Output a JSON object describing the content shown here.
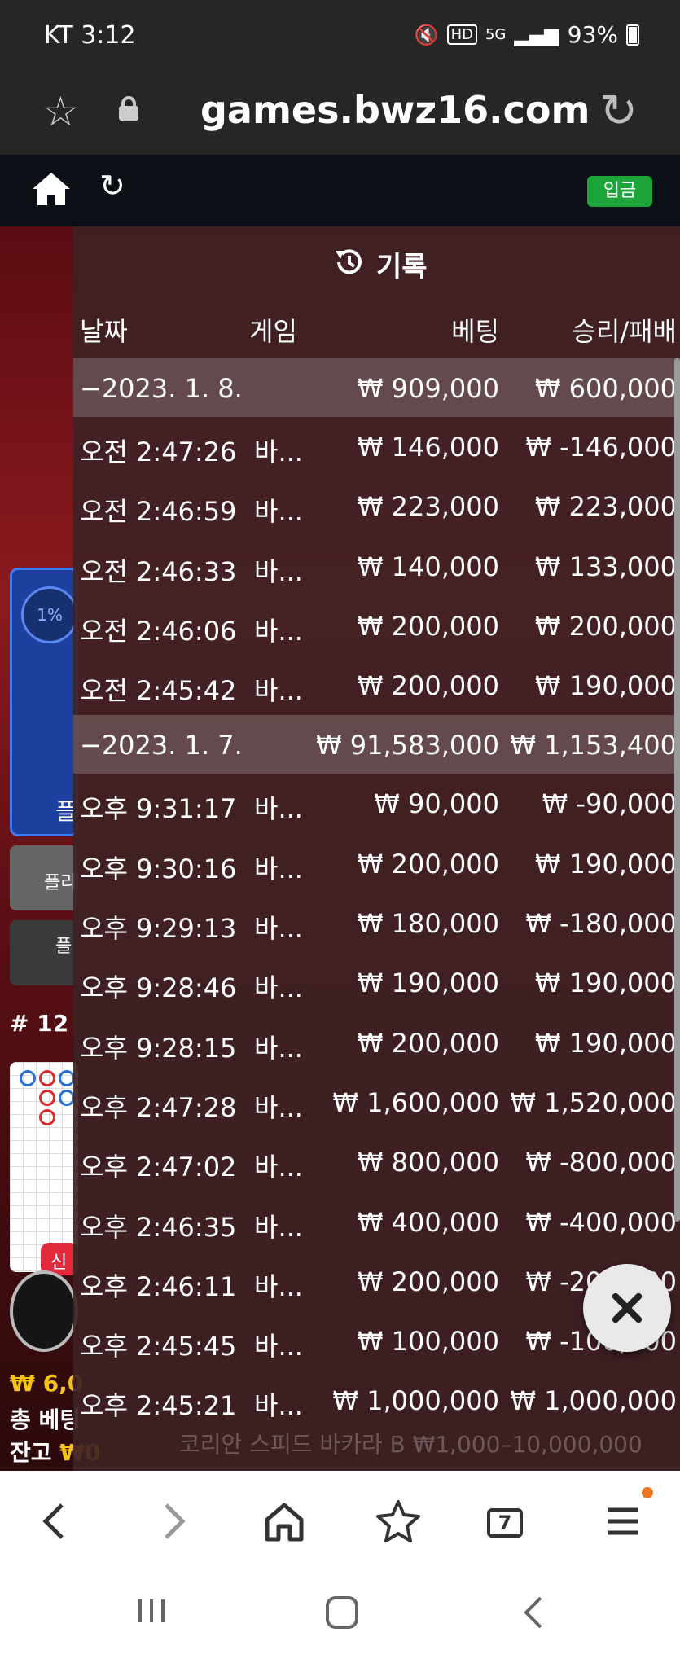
{
  "status_bar": {
    "carrier_time": "KT  3:12",
    "battery": "93%",
    "network": "5G"
  },
  "address_bar": {
    "url": "games.bwz16.com"
  },
  "site_header": {
    "deposit_label": "입금"
  },
  "left_panel": {
    "percent": "1%",
    "blue_label": "플",
    "gray_btn1": "플리",
    "gray_btn2": "플",
    "round_number": "# 12",
    "new_badge": "신",
    "money": "₩ 6,0",
    "total_bet_label": "총 베팅",
    "balance_label": "잔고",
    "balance_value": "₩0"
  },
  "history": {
    "title": "기록",
    "columns": {
      "date": "날짜",
      "game": "게임",
      "bet": "베팅",
      "win_loss": "승리/패배"
    },
    "rows": [
      {
        "type": "date",
        "time": "−2023. 1. 8.",
        "game": "",
        "bet": "₩ 909,000",
        "win": "₩ 600,000"
      },
      {
        "type": "entry",
        "time": "오전 2:47:26",
        "game": "바...",
        "bet": "₩ 146,000",
        "win": "₩ -146,000"
      },
      {
        "type": "entry",
        "time": "오전 2:46:59",
        "game": "바...",
        "bet": "₩ 223,000",
        "win": "₩ 223,000"
      },
      {
        "type": "entry",
        "time": "오전 2:46:33",
        "game": "바...",
        "bet": "₩ 140,000",
        "win": "₩ 133,000"
      },
      {
        "type": "entry",
        "time": "오전 2:46:06",
        "game": "바...",
        "bet": "₩ 200,000",
        "win": "₩ 200,000"
      },
      {
        "type": "entry",
        "time": "오전 2:45:42",
        "game": "바...",
        "bet": "₩ 200,000",
        "win": "₩ 190,000"
      },
      {
        "type": "date",
        "time": "−2023. 1. 7.",
        "game": "",
        "bet": "₩ 91,583,000",
        "win": "₩ 1,153,400"
      },
      {
        "type": "entry",
        "time": "오후 9:31:17",
        "game": "바...",
        "bet": "₩ 90,000",
        "win": "₩ -90,000"
      },
      {
        "type": "entry",
        "time": "오후 9:30:16",
        "game": "바...",
        "bet": "₩ 200,000",
        "win": "₩ 190,000"
      },
      {
        "type": "entry",
        "time": "오후 9:29:13",
        "game": "바...",
        "bet": "₩ 180,000",
        "win": "₩ -180,000"
      },
      {
        "type": "entry",
        "time": "오후 9:28:46",
        "game": "바...",
        "bet": "₩ 190,000",
        "win": "₩ 190,000"
      },
      {
        "type": "entry",
        "time": "오후 9:28:15",
        "game": "바...",
        "bet": "₩ 200,000",
        "win": "₩ 190,000"
      },
      {
        "type": "entry",
        "time": "오후 2:47:28",
        "game": "바...",
        "bet": "₩ 1,600,000",
        "win": "₩ 1,520,000"
      },
      {
        "type": "entry",
        "time": "오후 2:47:02",
        "game": "바...",
        "bet": "₩ 800,000",
        "win": "₩ -800,000"
      },
      {
        "type": "entry",
        "time": "오후 2:46:35",
        "game": "바...",
        "bet": "₩ 400,000",
        "win": "₩ -400,000"
      },
      {
        "type": "entry",
        "time": "오후 2:46:11",
        "game": "바...",
        "bet": "₩ 200,000",
        "win": "₩ -200,000"
      },
      {
        "type": "entry",
        "time": "오후 2:45:45",
        "game": "바...",
        "bet": "₩ 100,000",
        "win": "₩ -100,000"
      },
      {
        "type": "entry",
        "time": "오후 2:45:21",
        "game": "바...",
        "bet": "₩ 1,000,000",
        "win": "₩ 1,000,000"
      }
    ]
  },
  "background_text": "코리안 스피드 바카라 B ₩1,000–10,000,000",
  "browser_toolbar": {
    "tabs_count": "7"
  },
  "colors": {
    "accent_green": "#1ea53a",
    "overlay": "#3e2224",
    "gold": "#f7c31b",
    "notif": "#f07420"
  }
}
